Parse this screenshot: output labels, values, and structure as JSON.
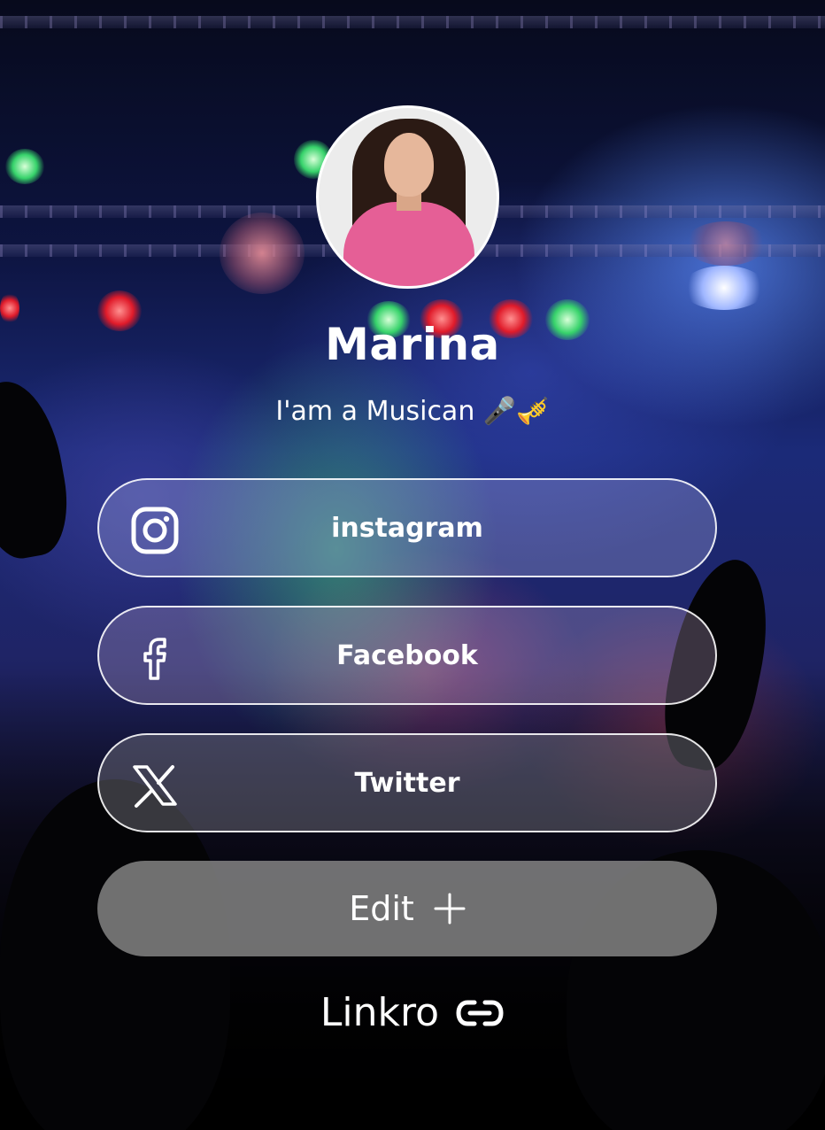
{
  "profile": {
    "name": "Marina",
    "bio": "I'am a Musican 🎤🎺"
  },
  "links": [
    {
      "label": "instagram",
      "icon": "instagram-icon"
    },
    {
      "label": "Facebook",
      "icon": "facebook-icon"
    },
    {
      "label": "Twitter",
      "icon": "x-twitter-icon"
    }
  ],
  "edit": {
    "label": "Edit",
    "icon": "plus-icon"
  },
  "brand": {
    "label": "Linkro",
    "icon": "link-chain-icon"
  },
  "colors": {
    "text": "#ffffff",
    "card_border": "#ffffff",
    "edit_button": "#808080"
  }
}
